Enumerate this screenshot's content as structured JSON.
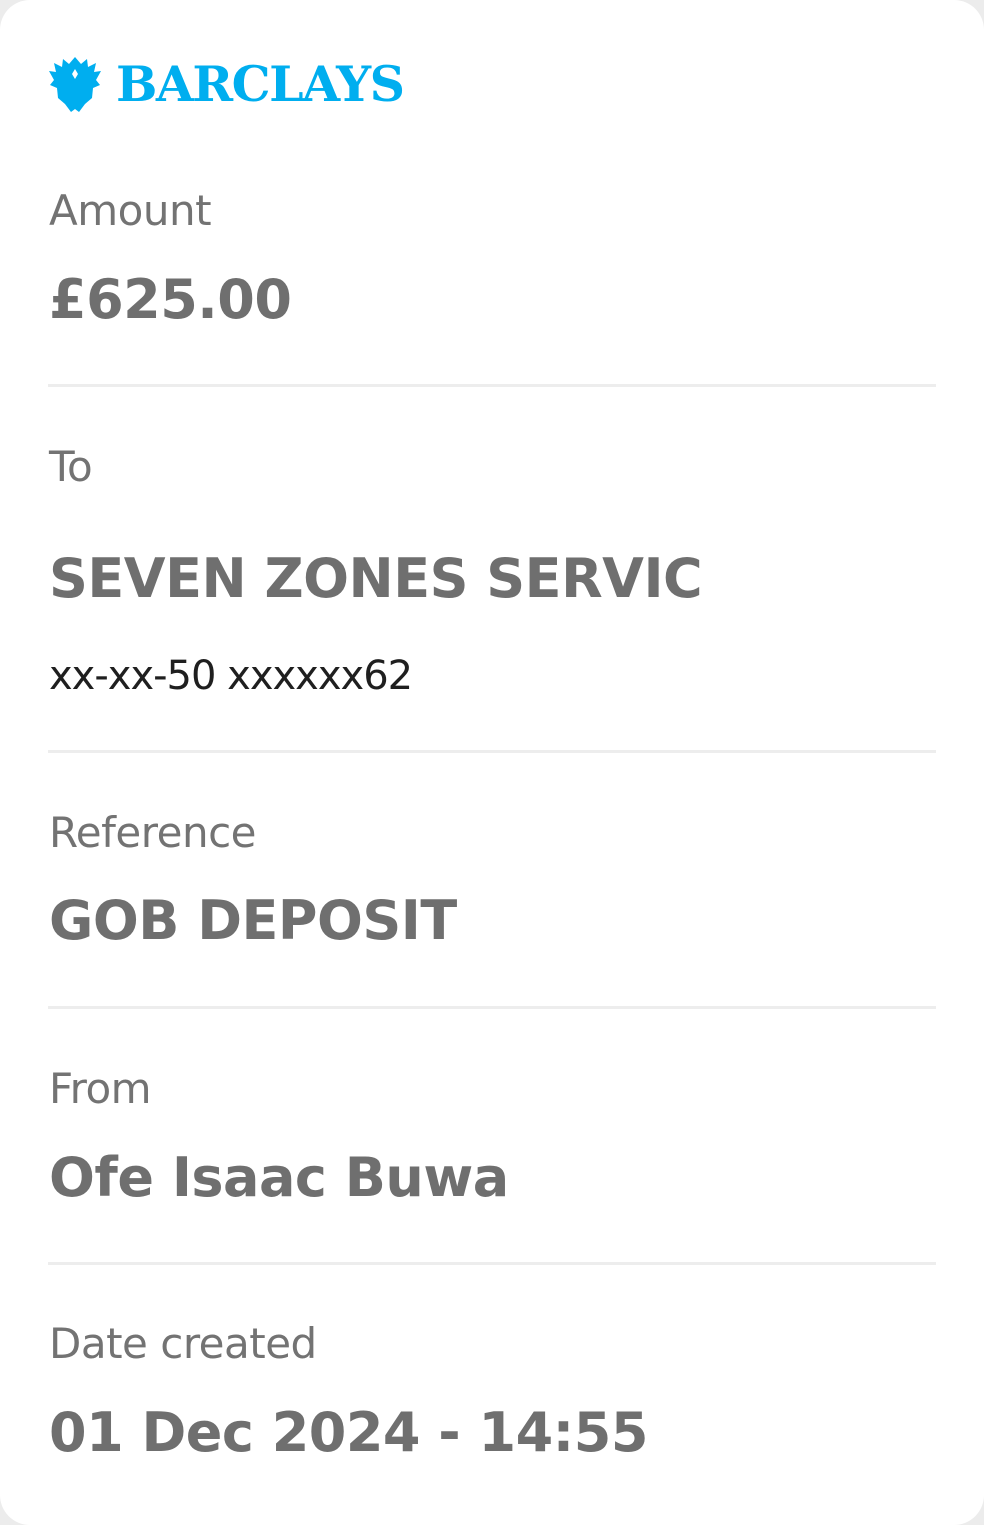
{
  "brand": {
    "name": "BARCLAYS",
    "icon": "eagle-icon"
  },
  "amount": {
    "label": "Amount",
    "value": "£625.00"
  },
  "to": {
    "label": "To",
    "value": "SEVEN ZONES SERVIC",
    "account": "xx-xx-50 xxxxxx62"
  },
  "reference": {
    "label": "Reference",
    "value": "GOB DEPOSIT"
  },
  "from": {
    "label": "From",
    "value": "Ofe Isaac Buwa"
  },
  "date_created": {
    "label": "Date created",
    "value": "01 Dec 2024 - 14:55"
  },
  "colors": {
    "brand": "#00aeef",
    "label_text": "#737373",
    "value_text": "#6f6f6f",
    "account_text": "#1f1f1f",
    "divider": "#ededed",
    "card_background": "#ffffff"
  }
}
